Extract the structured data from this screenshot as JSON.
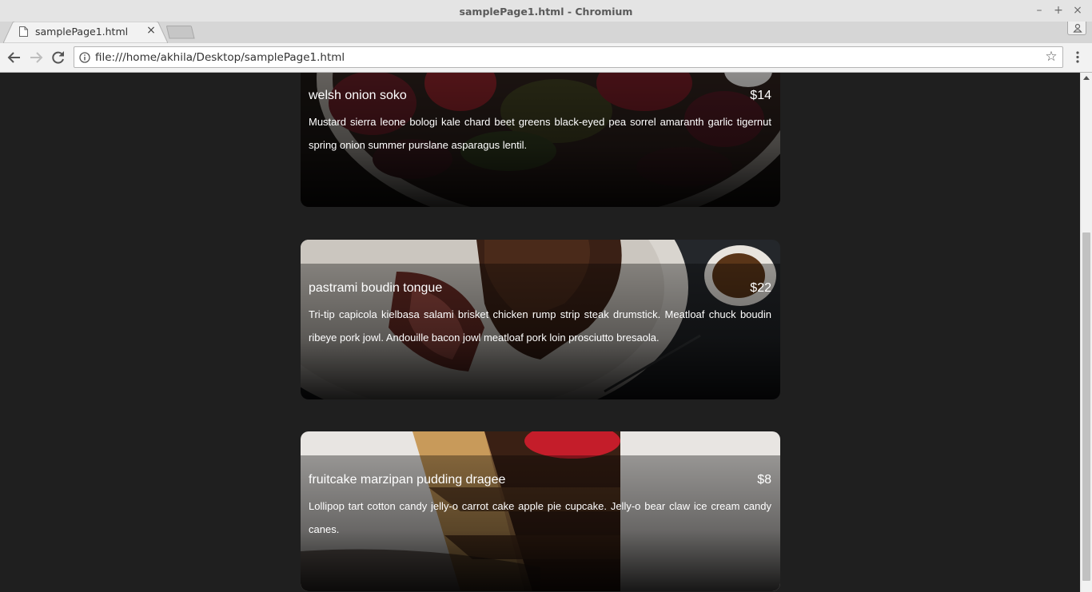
{
  "window": {
    "title": "samplePage1.html - Chromium",
    "controls": {
      "minimize": "–",
      "maximize": "+",
      "close": "×"
    }
  },
  "tabs": [
    {
      "label": "samplePage1.html",
      "close": "×",
      "icon": "page-icon"
    }
  ],
  "toolbar": {
    "url": "file:///home/akhila/Desktop/samplePage1.html",
    "star": "☆"
  },
  "menu": [
    {
      "name": "welsh onion soko",
      "price": "$14",
      "description": "Mustard sierra leone bologi kale chard beet greens black-eyed pea sorrel amaranth garlic tigernut spring onion summer purslane asparagus lentil."
    },
    {
      "name": "pastrami boudin tongue",
      "price": "$22",
      "description": "Tri-tip capicola kielbasa salami brisket chicken rump strip steak drumstick. Meatloaf chuck boudin ribeye pork jowl. Andouille bacon jowl meatloaf pork loin prosciutto bresaola."
    },
    {
      "name": "fruitcake marzipan pudding dragee",
      "price": "$8",
      "description": "Lollipop tart cotton candy jelly-o carrot cake apple pie cupcake. Jelly-o bear claw ice cream candy canes."
    }
  ],
  "colors": {
    "page_background": "#1f1f1f",
    "text": "#ffffff"
  }
}
